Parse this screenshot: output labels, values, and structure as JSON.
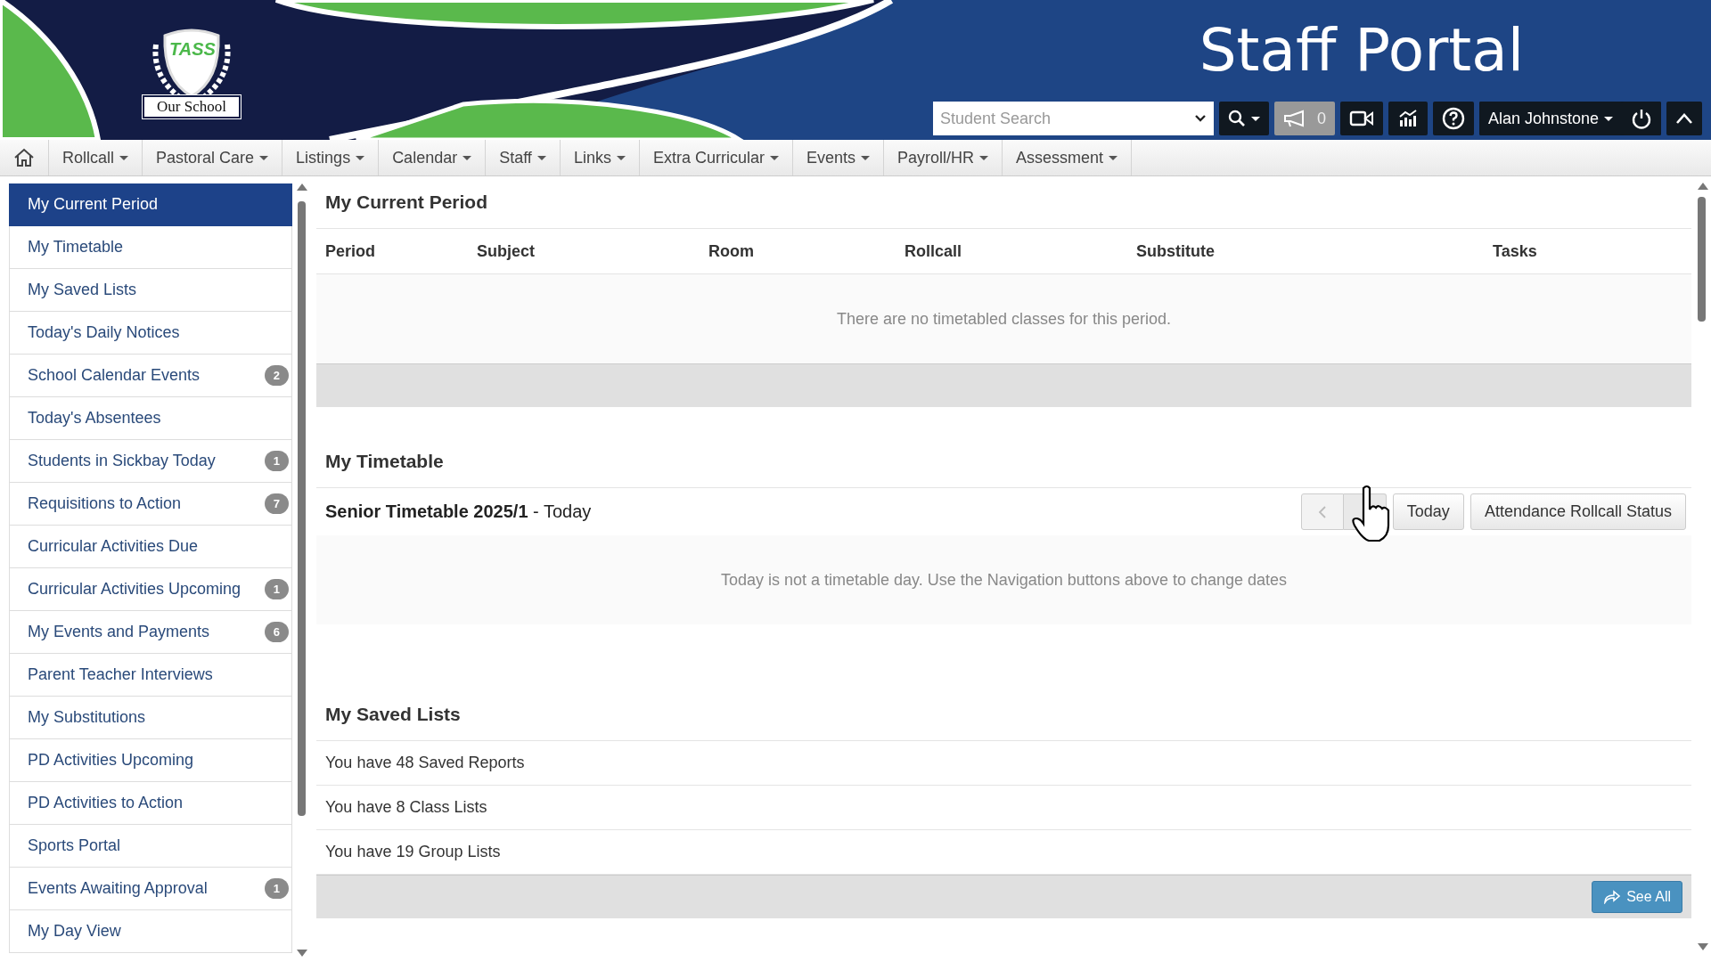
{
  "header": {
    "logo_text": "TASS",
    "school_name": "Our School",
    "title": "Staff Portal",
    "search": {
      "placeholder": "Student Search"
    },
    "notification_count": "0",
    "user": "Alan Johnstone"
  },
  "nav": [
    {
      "label": "Rollcall"
    },
    {
      "label": "Pastoral Care"
    },
    {
      "label": "Listings"
    },
    {
      "label": "Calendar"
    },
    {
      "label": "Staff"
    },
    {
      "label": "Links"
    },
    {
      "label": "Extra Curricular"
    },
    {
      "label": "Events"
    },
    {
      "label": "Payroll/HR"
    },
    {
      "label": "Assessment"
    }
  ],
  "sidebar": {
    "items": [
      {
        "label": "My Current Period",
        "selected": true
      },
      {
        "label": "My Timetable",
        "selected": false
      },
      {
        "label": "My Saved Lists",
        "selected": false
      },
      {
        "label": "Today's Daily Notices",
        "selected": false
      },
      {
        "label": "School Calendar Events",
        "selected": false,
        "badge": "2"
      },
      {
        "label": "Today's Absentees",
        "selected": false
      },
      {
        "label": "Students in Sickbay Today",
        "selected": false,
        "badge": "1"
      },
      {
        "label": "Requisitions to Action",
        "selected": false,
        "badge": "7"
      },
      {
        "label": "Curricular Activities Due",
        "selected": false
      },
      {
        "label": "Curricular Activities Upcoming",
        "selected": false,
        "badge": "1"
      },
      {
        "label": "My Events and Payments",
        "selected": false,
        "badge": "6"
      },
      {
        "label": "Parent Teacher Interviews",
        "selected": false
      },
      {
        "label": "My Substitutions",
        "selected": false
      },
      {
        "label": "PD Activities Upcoming",
        "selected": false
      },
      {
        "label": "PD Activities to Action",
        "selected": false
      },
      {
        "label": "Sports Portal",
        "selected": false
      },
      {
        "label": "Events Awaiting Approval",
        "selected": false,
        "badge": "1"
      },
      {
        "label": "My Day View",
        "selected": false
      }
    ]
  },
  "current_period": {
    "title": "My Current Period",
    "columns": [
      "Period",
      "Subject",
      "Room",
      "Rollcall",
      "Substitute",
      "Tasks"
    ],
    "empty_message": "There are no timetabled classes for this period."
  },
  "timetable": {
    "title": "My Timetable",
    "timetable_name": "Senior Timetable 2025/1",
    "date_label": "- Today",
    "buttons": [
      "Today",
      "Attendance Rollcall Status"
    ],
    "message": "Today is not a timetable day. Use the Navigation buttons above to change dates"
  },
  "saved_lists": {
    "title": "My Saved Lists",
    "rows": [
      "You have 48 Saved Reports",
      "You have 8 Class Lists",
      "You have 19 Group Lists"
    ],
    "see_all": "See All"
  }
}
